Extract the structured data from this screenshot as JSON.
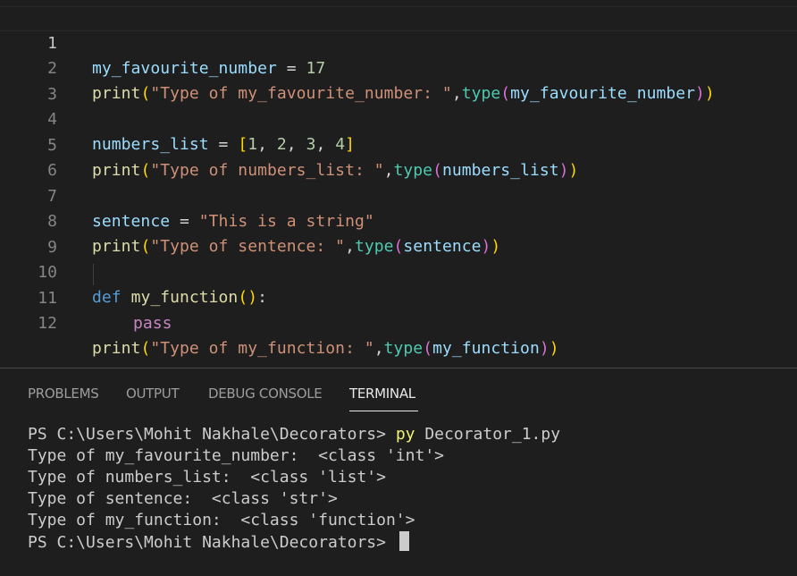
{
  "editor": {
    "lines": [
      {
        "number": "1",
        "text": "my_favourite_number = 17"
      },
      {
        "number": "2",
        "text": "print(\"Type of my_favourite_number: \",type(my_favourite_number))"
      },
      {
        "number": "3",
        "text": ""
      },
      {
        "number": "4",
        "text": "numbers_list = [1, 2, 3, 4]"
      },
      {
        "number": "5",
        "text": "print(\"Type of numbers_list: \",type(numbers_list))"
      },
      {
        "number": "6",
        "text": ""
      },
      {
        "number": "7",
        "text": "sentence = \"This is a string\""
      },
      {
        "number": "8",
        "text": "print(\"Type of sentence: \",type(sentence))"
      },
      {
        "number": "9",
        "text": ""
      },
      {
        "number": "10",
        "text": "def my_function():"
      },
      {
        "number": "11",
        "text": "    pass"
      },
      {
        "number": "12",
        "text": "print(\"Type of my_function: \",type(my_function))"
      }
    ],
    "tokens": {
      "l1_var": "my_favourite_number",
      "l1_eq": " = ",
      "l1_num": "17",
      "print": "print",
      "type": "type",
      "lparen": "(",
      "rparen": ")",
      "comma": ",",
      "l2_str": "\"Type of my_favourite_number: \"",
      "l2_arg": "my_favourite_number",
      "l4_var": "numbers_list",
      "l4_eq": " = ",
      "l4_lbr": "[",
      "l4_rbr": "]",
      "l4_n1": "1",
      "l4_n2": "2",
      "l4_n3": "3",
      "l4_n4": "4",
      "l4_sep": ", ",
      "l5_str": "\"Type of numbers_list: \"",
      "l5_arg": "numbers_list",
      "l7_var": "sentence",
      "l7_eq": " = ",
      "l7_str": "\"This is a string\"",
      "l8_str": "\"Type of sentence: \"",
      "l8_arg": "sentence",
      "l10_def": "def",
      "l10_name": "my_function",
      "l10_parens": "()",
      "l10_colon": ":",
      "l11_pass": "pass",
      "l12_str": "\"Type of my_function: \"",
      "l12_arg": "my_function"
    }
  },
  "panel": {
    "tabs": [
      "PROBLEMS",
      "OUTPUT",
      "DEBUG CONSOLE",
      "TERMINAL"
    ],
    "active_tab": "TERMINAL"
  },
  "terminal": {
    "prompt": "PS C:\\Users\\Mohit Nakhale\\Decorators> ",
    "command": "py",
    "command_args": " Decorator_1.py",
    "output": [
      "Type of my_favourite_number:  <class 'int'>",
      "Type of numbers_list:  <class 'list'>",
      "Type of sentence:  <class 'str'>",
      "Type of my_function:  <class 'function'>"
    ],
    "final_prompt": "PS C:\\Users\\Mohit Nakhale\\Decorators> "
  },
  "colors": {
    "background": "#1e1e1e",
    "variable": "#9cdcfe",
    "function": "#dcdcaa",
    "string": "#ce9178",
    "number": "#b5cea8",
    "keyword": "#569cd6",
    "control_keyword": "#c586c0",
    "builtin_class": "#4ec9b0",
    "terminal_text": "#cccccc",
    "terminal_command": "#f1f178"
  }
}
